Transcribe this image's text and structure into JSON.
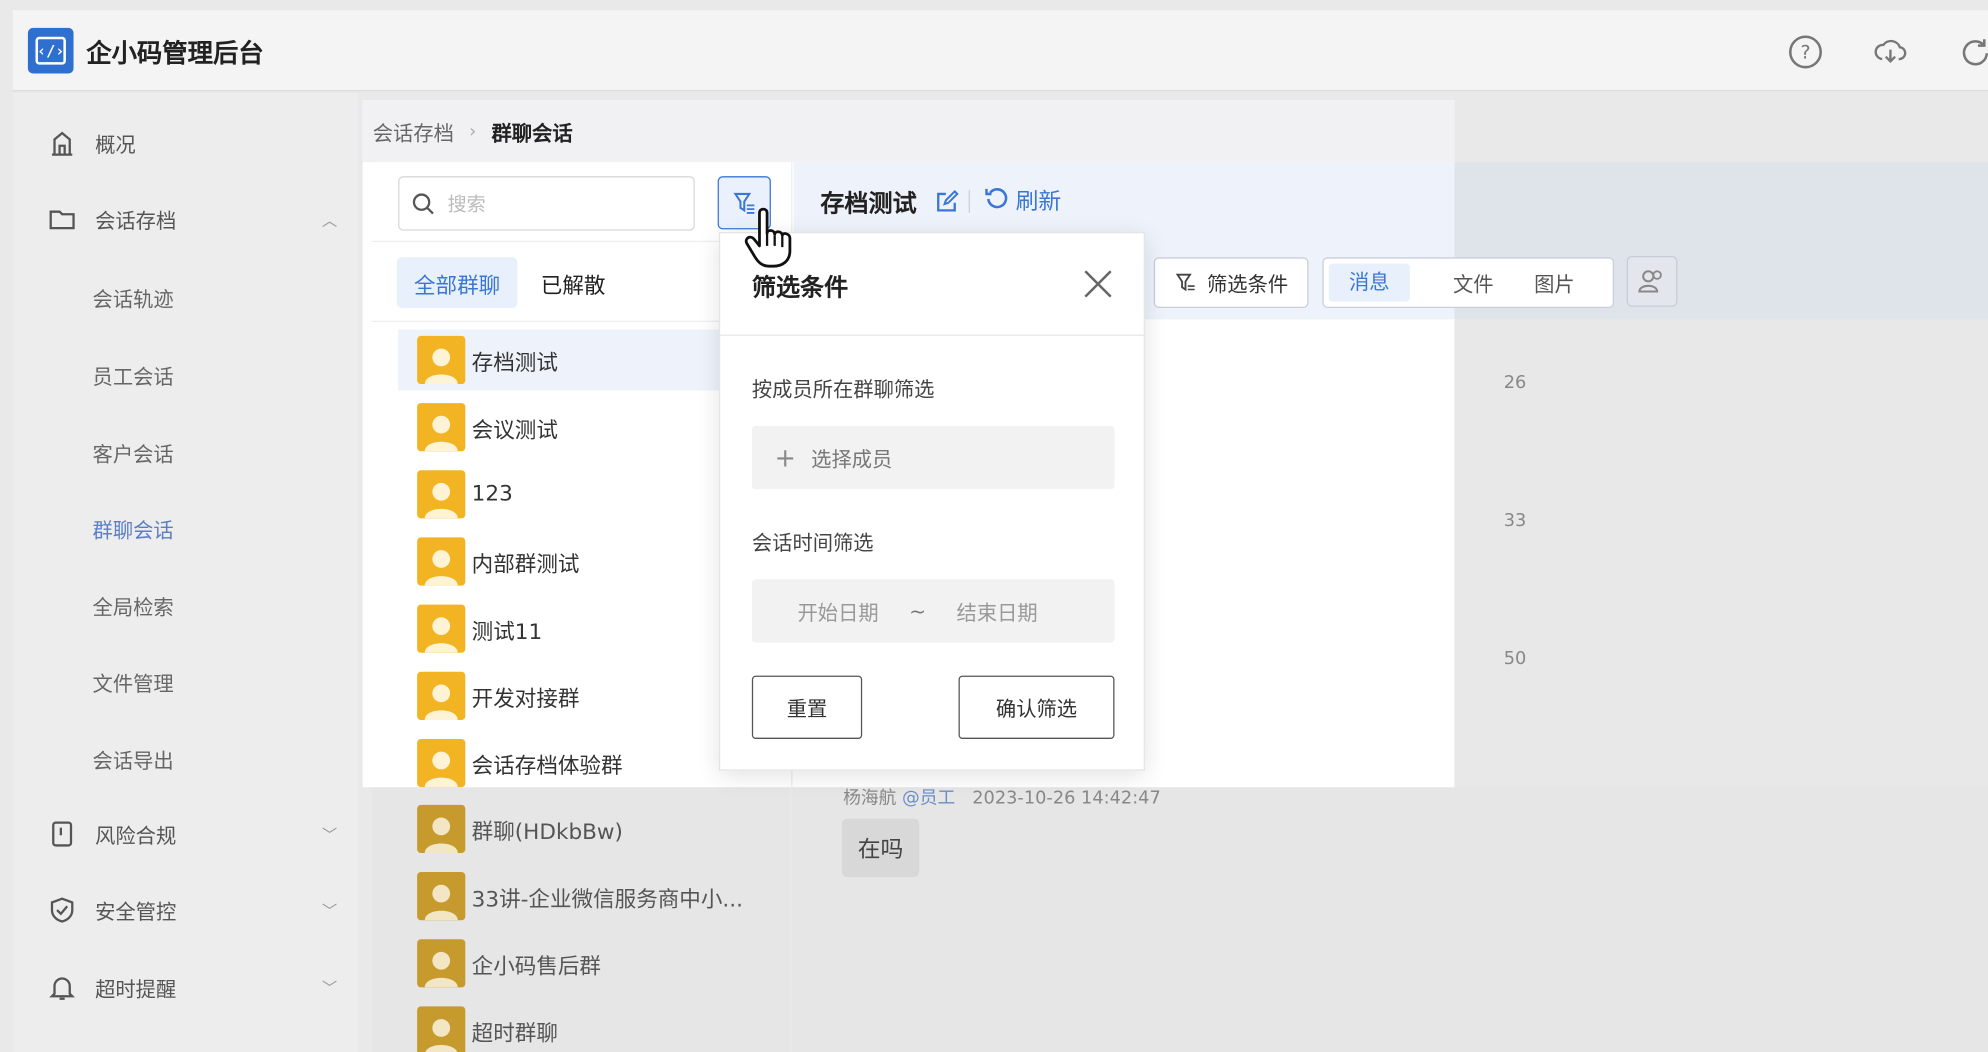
{
  "app": {
    "title": "企小码管理后台",
    "logo_glyph": "‹/›"
  },
  "topbar": {
    "icons": [
      "help-icon",
      "cloud-download-icon",
      "refresh-icon"
    ]
  },
  "sidebar": {
    "items": [
      {
        "label": "概况",
        "icon": "building-icon"
      },
      {
        "label": "会话存档",
        "icon": "folder-icon",
        "expanded": true
      },
      {
        "label": "风险合规",
        "icon": "book-icon"
      },
      {
        "label": "安全管控",
        "icon": "shield-check-icon"
      },
      {
        "label": "超时提醒",
        "icon": "bell-clock-icon"
      }
    ],
    "subitems": [
      {
        "label": "会话轨迹"
      },
      {
        "label": "员工会话"
      },
      {
        "label": "客户会话"
      },
      {
        "label": "群聊会话",
        "active": true
      },
      {
        "label": "全局检索"
      },
      {
        "label": "文件管理"
      },
      {
        "label": "会话导出"
      }
    ]
  },
  "breadcrumb": {
    "parent": "会话存档",
    "current": "群聊会话"
  },
  "search": {
    "placeholder": "搜索",
    "value": ""
  },
  "group_tabs": {
    "all": "全部群聊",
    "dissolved": "已解散"
  },
  "groups": [
    {
      "name": "存档测试",
      "selected": true
    },
    {
      "name": "会议测试"
    },
    {
      "name": "123"
    },
    {
      "name": "内部群测试"
    },
    {
      "name": "测试11"
    },
    {
      "name": "开发对接群"
    },
    {
      "name": "会话存档体验群"
    },
    {
      "name": "群聊(HDkbBw)"
    },
    {
      "name": "33讲-企业微信服务商中小..."
    },
    {
      "name": "企小码售后群"
    },
    {
      "name": "超时群聊"
    }
  ],
  "chat_header": {
    "title": "存档测试",
    "refresh": "刷新"
  },
  "toolbar": {
    "filter": "筛选条件",
    "tabs": [
      "消息",
      "文件",
      "图片"
    ],
    "active_tab": "消息"
  },
  "time_fragments": [
    "26",
    "33",
    "50"
  ],
  "message": {
    "sender": "杨海航",
    "tag": "@员工",
    "time": "2023-10-26 14:42:47",
    "text": "在吗"
  },
  "filter_popup": {
    "title": "筛选条件",
    "member_label": "按成员所在群聊筛选",
    "member_button": "选择成员",
    "time_label": "会话时间筛选",
    "start_placeholder": "开始日期",
    "separator": "~",
    "end_placeholder": "结束日期",
    "reset": "重置",
    "confirm": "确认筛选"
  },
  "colors": {
    "accent": "#3a76d6",
    "avatar": "#f2b422",
    "logo": "#2f6fd0"
  }
}
